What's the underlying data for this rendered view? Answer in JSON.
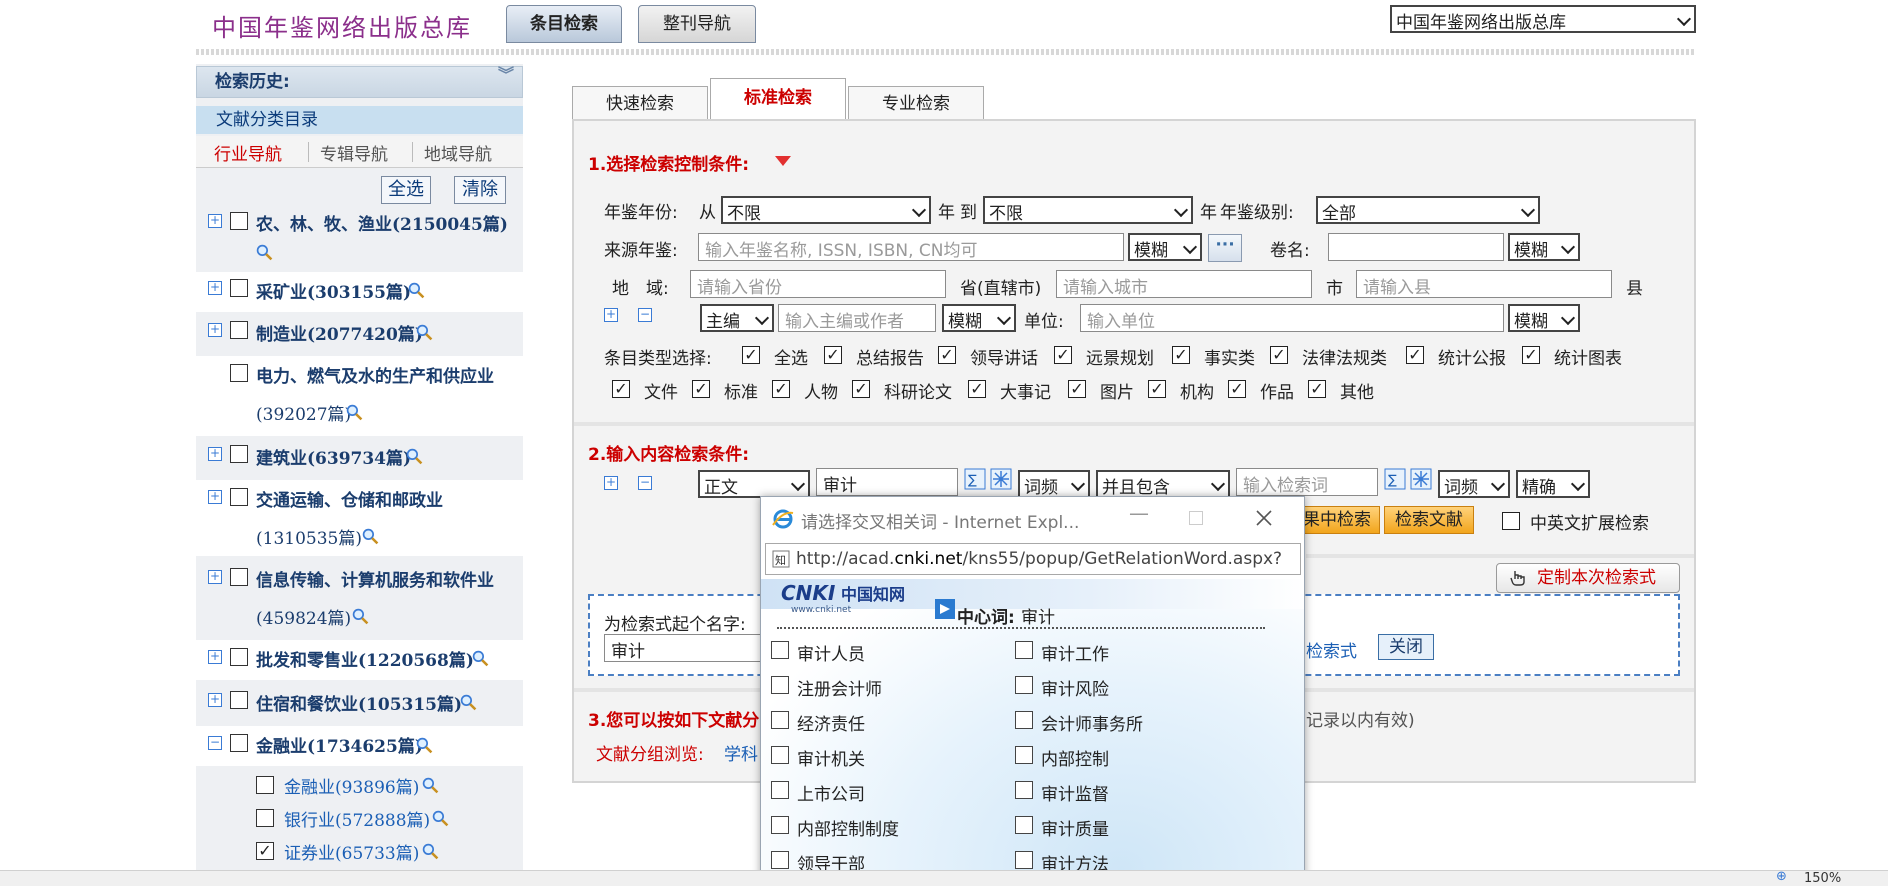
{
  "header": {
    "site_title": "中国年鉴网络出版总库",
    "tab_active": "条目检索",
    "tab_inactive": "整刊导航",
    "library_select": "中国年鉴网络出版总库"
  },
  "sidebar": {
    "history_label": "检索历史:",
    "catalog_label": "文献分类目录",
    "nav_tabs": [
      "行业导航",
      "专辑导航",
      "地域导航"
    ],
    "select_all": "全选",
    "clear": "清除",
    "categories": [
      {
        "line1": "农、林、牧、渔业(2150045篇)",
        "line2": ""
      },
      {
        "line1": "采矿业(303155篇)",
        "line2": ""
      },
      {
        "line1": "制造业(2077420篇)",
        "line2": ""
      },
      {
        "line1": "电力、燃气及水的生产和供应业",
        "line2": "(392027篇)"
      },
      {
        "line1": "建筑业(639734篇)",
        "line2": ""
      },
      {
        "line1": "交通运输、仓储和邮政业",
        "line2": "(1310535篇)"
      },
      {
        "line1": "信息传输、计算机服务和软件业",
        "line2": "(459824篇)"
      },
      {
        "line1": "批发和零售业(1220568篇)",
        "line2": ""
      },
      {
        "line1": "住宿和餐饮业(105315篇)",
        "line2": ""
      },
      {
        "line1": "金融业(1734625篇)",
        "line2": ""
      }
    ],
    "subcategories": [
      {
        "label": "金融业(93896篇)",
        "checked": false
      },
      {
        "label": "银行业(572888篇)",
        "checked": false
      },
      {
        "label": "证券业(65733篇)",
        "checked": true
      }
    ]
  },
  "search_tabs": [
    "快速检索",
    "标准检索",
    "专业检索"
  ],
  "section1": {
    "title": "1.选择检索控制条件:",
    "year_label": "年鉴年份:",
    "from": "从",
    "year_from": "不限",
    "year_unit": "年",
    "to": "到",
    "year_to": "不限",
    "year_unit2": "年",
    "level_label": "年鉴级别:",
    "level_value": "全部",
    "source_label": "来源年鉴:",
    "source_placeholder": "输入年鉴名称, ISSN, ISBN, CN均可",
    "fuzzy": "模糊",
    "volume_label": "卷名:",
    "region_label": "地　域:",
    "province_placeholder": "请输入省份",
    "province_label": "省(直辖市)",
    "city_placeholder": "请输入城市",
    "city_label": "市",
    "county_placeholder": "请输入县",
    "county_label": "县",
    "editor_select": "主编",
    "editor_placeholder": "输入主编或作者",
    "unit_label": "单位:",
    "unit_placeholder": "输入单位",
    "type_label": "条目类型选择:",
    "types_row1": [
      "全选",
      "总结报告",
      "领导讲话",
      "远景规划",
      "事实类",
      "法律法规类",
      "统计公报",
      "统计图表"
    ],
    "types_row2": [
      "文件",
      "标准",
      "人物",
      "科研论文",
      "大事记",
      "图片",
      "机构",
      "作品",
      "其他"
    ]
  },
  "section2": {
    "title": "2.输入内容检索条件:",
    "field_select": "正文",
    "keyword": "审计",
    "freq_select": "词频",
    "logic_select": "并且包含",
    "keyword2_placeholder": "输入检索词",
    "freq_select2": "词频",
    "match_select": "精确",
    "btn_search_in": "结果中检索",
    "btn_search_in_visible": "果中检索",
    "btn_search": "检索文献",
    "cross_lang": "中英文扩展检索",
    "custom_btn": "定制本次检索式",
    "name_label": "为检索式起个名字:",
    "name_value": "审计",
    "save_label": "检索式",
    "close_btn": "关闭"
  },
  "section3": {
    "title": "3.您可以按如下文献分",
    "note": "记录以内有效)",
    "group_label": "文献分组浏览:",
    "group_item": "学科"
  },
  "popup": {
    "title": "请选择交叉相关词 - Internet Expl...",
    "url_prefix": "http://acad.",
    "url_domain": "cnki.net",
    "url_path": "/kns55/popup/GetRelationWord.aspx?",
    "logo_text": "CNKI中国知网",
    "logo_sub": "www.cnki.net",
    "center_label": "中心词:",
    "center_word": "审计",
    "words_left": [
      "审计人员",
      "注册会计师",
      "经济责任",
      "审计机关",
      "上市公司",
      "内部控制制度",
      "领导干部"
    ],
    "words_right": [
      "审计工作",
      "审计风险",
      "会计师事务所",
      "内部控制",
      "审计监督",
      "审计质量",
      "审计方法"
    ]
  },
  "statusbar": {
    "zoom": "150%"
  },
  "colors": {
    "accent_red": "#cc0000",
    "title_purple": "#8b2f8b",
    "nav_blue": "#1b3d6d",
    "link_blue": "#1b5fb5",
    "button_orange": "#f2a51c"
  }
}
